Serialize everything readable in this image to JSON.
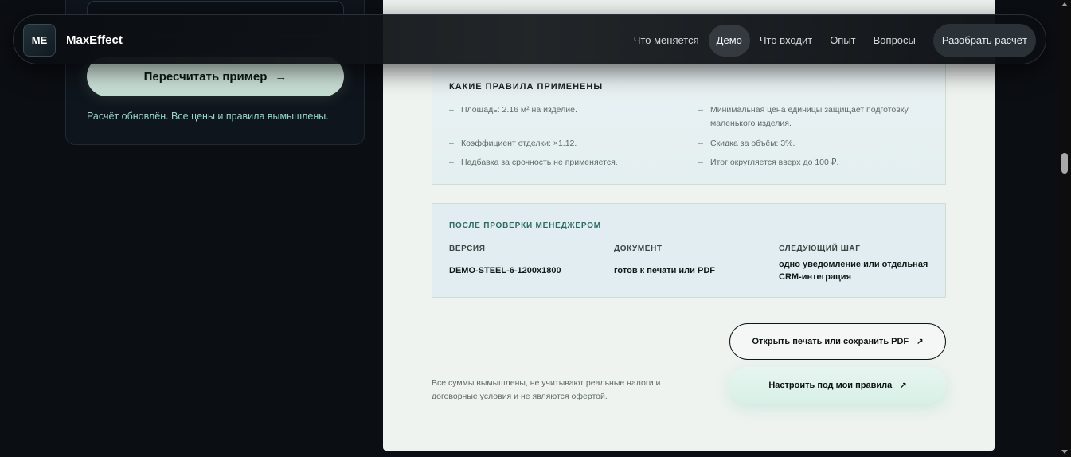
{
  "navbar": {
    "logo_text": "ME",
    "brand": "MaxEffect",
    "links": [
      {
        "label": "Что меняется",
        "active": false
      },
      {
        "label": "Демо",
        "active": true
      },
      {
        "label": "Что входит",
        "active": false
      },
      {
        "label": "Опыт",
        "active": false
      },
      {
        "label": "Вопросы",
        "active": false
      }
    ],
    "cta_label": "Разобрать расчёт"
  },
  "calculator": {
    "recalc_label": "Пересчитать пример",
    "recalc_arrow": "→",
    "status": "Расчёт обновлён. Все цены и правила вымышлены."
  },
  "rules": {
    "title": "КАКИЕ ПРАВИЛА ПРИМЕНЕНЫ",
    "items": [
      "Площадь: 2.16 м² на изделие.",
      "Минимальная цена единицы защищает подготовку маленького изделия.",
      "Коэффициент отделки: ×1.12.",
      "Скидка за объём: 3%.",
      "Надбавка за срочность не применяется.",
      "Итог округляется вверх до 100 ₽."
    ]
  },
  "manager": {
    "title": "ПОСЛЕ ПРОВЕРКИ МЕНЕДЖЕРОМ",
    "columns": [
      {
        "head": "ВЕРСИЯ",
        "value": "DEMO-STEEL-6-1200x1800"
      },
      {
        "head": "ДОКУМЕНТ",
        "value": "готов к печати или PDF"
      },
      {
        "head": "СЛЕДУЮЩИЙ ШАГ",
        "value": "одно уведомление или отдельная CRM-интеграция"
      }
    ]
  },
  "footer": {
    "disclaimer": "Все суммы вымышлены, не учитывают реальные налоги и договорные условия и не являются офертой.",
    "print_label": "Открыть печать или сохранить PDF",
    "setup_label": "Настроить под мои правила",
    "external_icon": "↗"
  },
  "colors": {
    "accent_mint": "#8fd8c6",
    "doc_background": "#eef3f0",
    "page_background": "#0b0e13"
  }
}
